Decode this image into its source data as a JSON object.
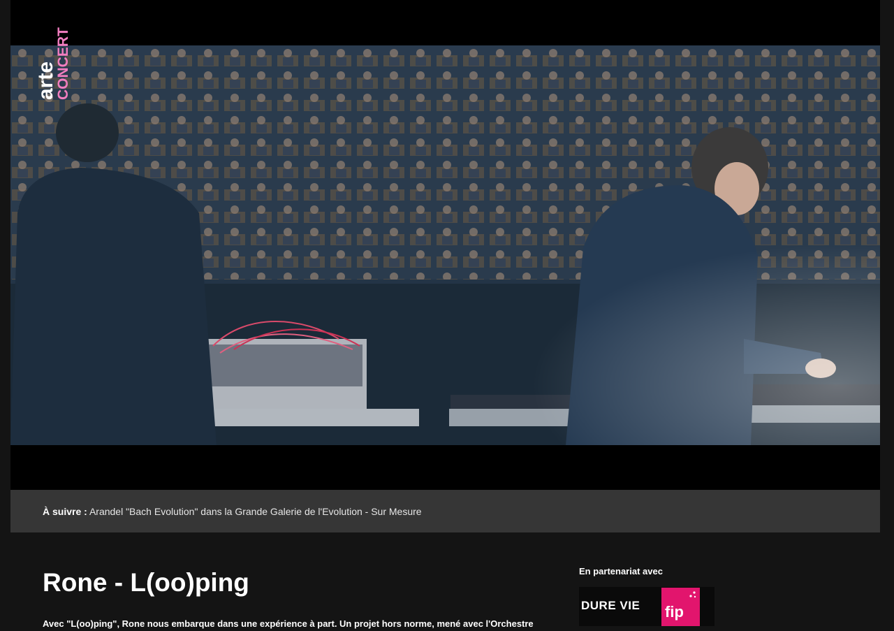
{
  "player": {
    "brand_top": "arte",
    "brand_bottom": "CONCERT"
  },
  "up_next": {
    "label": "À suivre :",
    "title": "Arandel \"Bach Evolution\" dans la Grande Galerie de l'Evolution - Sur Mesure"
  },
  "main": {
    "title": "Rone - L(oo)ping",
    "description": "Avec \"L(oo)ping\", Rone nous embarque dans une expérience à part. Un projet hors norme, mené avec l'Orchestre"
  },
  "partner": {
    "label": "En partenariat avec",
    "logo_1": "DURE VIE",
    "logo_2": "fip"
  },
  "colors": {
    "background": "#141414",
    "up_next_bar": "#363636",
    "fip_pink": "#e2156d",
    "arte_pink": "#f27ec0"
  }
}
